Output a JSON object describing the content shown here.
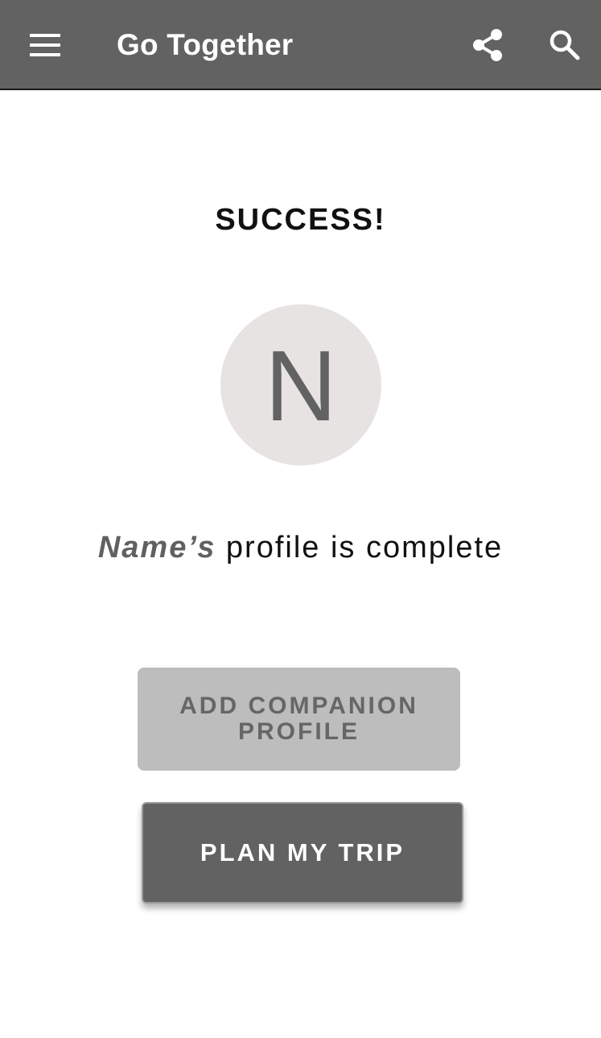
{
  "app_bar": {
    "title": "Go Together",
    "menu_icon": "hamburger-menu-icon",
    "share_icon": "share-icon",
    "search_icon": "search-icon",
    "background_color": "#626262"
  },
  "main": {
    "heading": "SUCCESS!",
    "avatar": {
      "initial": "N",
      "background_color": "#e6e3e2"
    },
    "status": {
      "name": "Name’s",
      "message": " profile is complete"
    },
    "buttons": {
      "add_companion_label": "ADD COMPANION PROFILE",
      "plan_trip_label": "PLAN MY TRIP"
    }
  }
}
